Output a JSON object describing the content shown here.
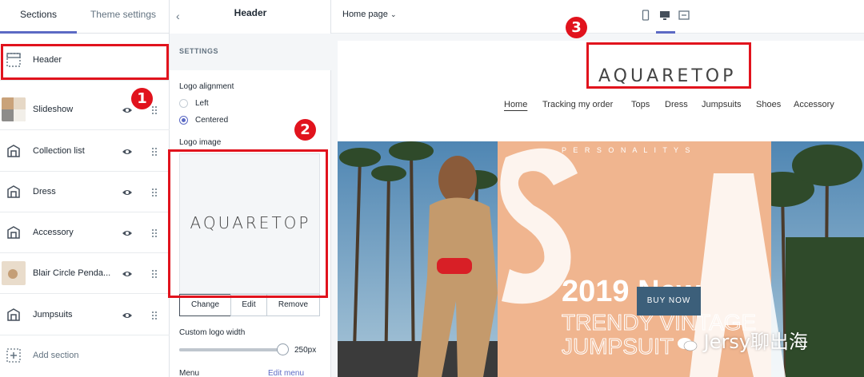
{
  "sidebar": {
    "tabs": [
      "Sections",
      "Theme settings"
    ],
    "sections": [
      {
        "label": "Header",
        "icon": "header-layout-icon"
      },
      {
        "label": "Slideshow",
        "icon": "slideshow-thumbnail"
      },
      {
        "label": "Collection list",
        "icon": "collection-icon"
      },
      {
        "label": "Dress",
        "icon": "collection-icon"
      },
      {
        "label": "Accessory",
        "icon": "collection-icon"
      },
      {
        "label": "Blair Circle Penda...",
        "icon": "product-thumbnail"
      },
      {
        "label": "Jumpsuits",
        "icon": "collection-icon"
      }
    ],
    "add_section": "Add section"
  },
  "settings_panel": {
    "title": "Header",
    "section_heading": "SETTINGS",
    "logo_alignment_label": "Logo alignment",
    "alignment_options": [
      "Left",
      "Centered"
    ],
    "alignment_selected": "Centered",
    "logo_image_label": "Logo image",
    "logo_text": "AQUARETOP",
    "buttons": [
      "Change",
      "Edit",
      "Remove"
    ],
    "custom_logo_width_label": "Custom logo width",
    "custom_logo_width_value": "250px",
    "menu_label": "Menu",
    "edit_menu_link": "Edit menu"
  },
  "preview": {
    "page_selector": "Home page",
    "logo_text": "AQUARETOP",
    "nav": [
      "Home",
      "Tracking my order",
      "Tops",
      "Dress",
      "Jumpsuits",
      "Shoes",
      "Accessory"
    ],
    "hero": {
      "brand_line": "P E R S O N A L I T Y S",
      "headline_year": "2019 New",
      "headline_line2": "TRENDY VINTAGE",
      "headline_line3": "JUMPSUIT",
      "button": "BUY NOW"
    }
  },
  "annotations": [
    "1",
    "2",
    "3"
  ],
  "watermark": "Jersy聊出海",
  "colors": {
    "accent": "#5c6ac4",
    "annotation_red": "#e1131d",
    "hero_peach": "#f0b58f",
    "button_blue": "#3c5f7a"
  }
}
